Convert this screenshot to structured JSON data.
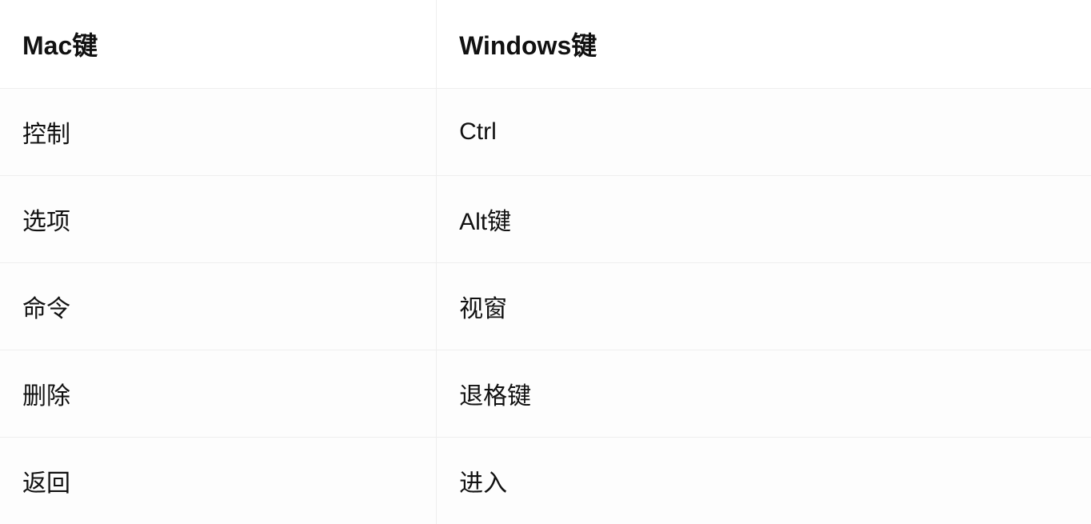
{
  "table": {
    "headers": {
      "mac": "Mac键",
      "windows": "Windows键"
    },
    "rows": [
      {
        "mac": "控制",
        "windows": "Ctrl"
      },
      {
        "mac": "选项",
        "windows": "Alt键"
      },
      {
        "mac": "命令",
        "windows": "视窗"
      },
      {
        "mac": "删除",
        "windows": "退格键"
      },
      {
        "mac": "返回",
        "windows": "进入"
      }
    ]
  }
}
